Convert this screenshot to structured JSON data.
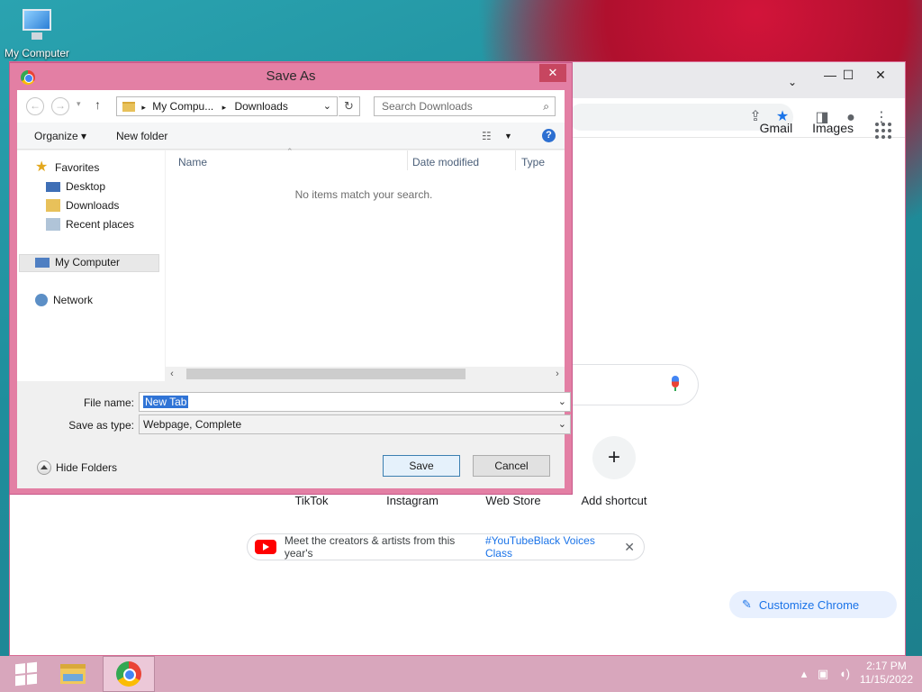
{
  "desktop": {
    "icon_label": "My Computer"
  },
  "chrome": {
    "top_links": [
      "Gmail",
      "Images"
    ],
    "shortcuts": [
      {
        "label": "TikTok",
        "icon": "tiktok-icon"
      },
      {
        "label": "Instagram",
        "icon": "instagram-icon"
      },
      {
        "label": "Web Store",
        "icon": "webstore-icon"
      },
      {
        "label": "Add shortcut",
        "icon": "plus-icon"
      }
    ],
    "promo": {
      "text": "Meet the creators & artists from this year's ",
      "tag": "#YouTubeBlack Voices Class",
      "close": "✕"
    },
    "customize_label": "Customize Chrome"
  },
  "dialog": {
    "title": "Save As",
    "close_glyph": "✕",
    "address": {
      "segments": [
        "My Compu...",
        "Downloads"
      ]
    },
    "search_placeholder": "Search Downloads",
    "commands": {
      "organize": "Organize ▾",
      "new_folder": "New folder"
    },
    "nav": {
      "favorites": "Favorites",
      "desktop": "Desktop",
      "downloads": "Downloads",
      "recent": "Recent places",
      "my_computer": "My Computer",
      "network": "Network"
    },
    "columns": [
      "Name",
      "Date modified",
      "Type"
    ],
    "empty_message": "No items match your search.",
    "file_name_label": "File name:",
    "file_name_value": "New Tab",
    "save_type_label": "Save as type:",
    "save_type_value": "Webpage, Complete",
    "hide_folders": "Hide Folders",
    "save_button": "Save",
    "cancel_button": "Cancel"
  },
  "taskbar": {
    "time": "2:17 PM",
    "date": "11/15/2022"
  },
  "colors": {
    "dialog_frame": "#e37fa4",
    "taskbar": "#d8a6bc",
    "accent_blue": "#1a73e8"
  }
}
